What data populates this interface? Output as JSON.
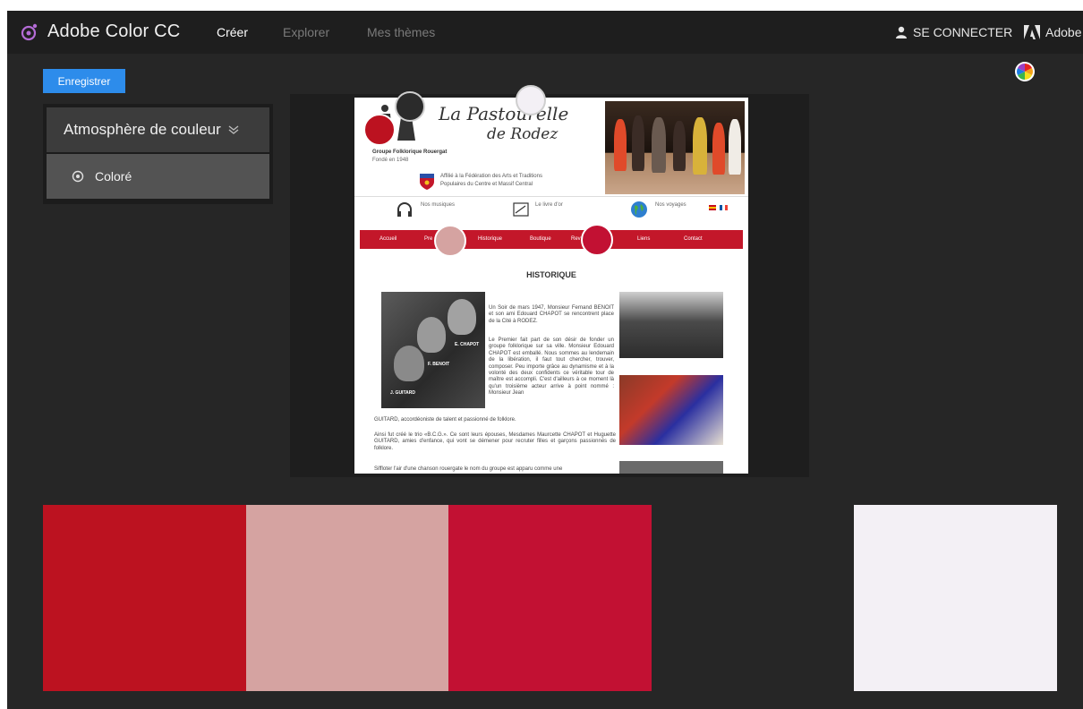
{
  "topbar": {
    "brand": "Adobe Color CC",
    "nav": [
      {
        "label": "Créer",
        "active": true
      },
      {
        "label": "Explorer",
        "active": false
      },
      {
        "label": "Mes thèmes",
        "active": false
      }
    ],
    "login_label": "SE CONNECTER",
    "adobe_label": "Adobe"
  },
  "toolbar": {
    "save_label": "Enregistrer"
  },
  "mood": {
    "title": "Atmosphère de couleur",
    "selected": "Coloré"
  },
  "preview": {
    "site_title_1": "La Pastourelle",
    "site_title_2": "de Rodez",
    "group_name": "Groupe Folklorique Rouergat",
    "founded": "Fondé en 1948",
    "affiliation": "Affilié à la Fédération des Arts et Traditions Populaires du Centre et Massif Central",
    "icons": [
      "Nos musiques",
      "Le livre d'or",
      "Nos voyages"
    ],
    "menu": [
      "Accueil",
      "Pre",
      "Historique",
      "Boutique",
      "Rev",
      "e",
      "Liens",
      "Contact"
    ],
    "heading": "HISTORIQUE",
    "photo_labels": [
      "E. CHAPOT",
      "F. BENOIT",
      "J. GUITARD"
    ],
    "para1": "Un Soir de mars 1947, Monsieur Fernand BENOIT et son ami Edouard CHAPOT se rencontrent place de la Cité à RODEZ.",
    "para2": "Le Premier fait part de son désir de fonder un groupe folklorique sur sa ville. Monsieur Edouard CHAPOT est emballé. Nous sommes au lendemain de la libération, il faut tout chercher, trouver, composer. Peu importe grâce au dynamisme et à la volonté des deux confidents ce véritable tour de maître est accompli. C'est d'ailleurs à ce moment là qu'un troisième acteur arrive à point nommé : Monsieur Jean",
    "para2b": "GUITARD, accordéoniste de talent et passionné de folklore.",
    "para3": "Ainsi fut créé le trio «B.C.G.». Ce sont leurs épouses, Mesdames Maurcette CHAPOT et Huguette GUITARD, amies d'enfance, qui vont se démener pour recruter filles et garçons passionnés de folklore.",
    "para4": "Siffloter l'air d'une chanson rouergate le nom du groupe est apparu comme une"
  },
  "colors": {
    "accent": "#2d8ceb",
    "topbar_bg": "#1e1e1e",
    "app_bg": "#262626"
  },
  "swatches": [
    "#bc1220",
    "#d5a3a1",
    "#c21133",
    "#262626",
    "#f3f0f5"
  ]
}
